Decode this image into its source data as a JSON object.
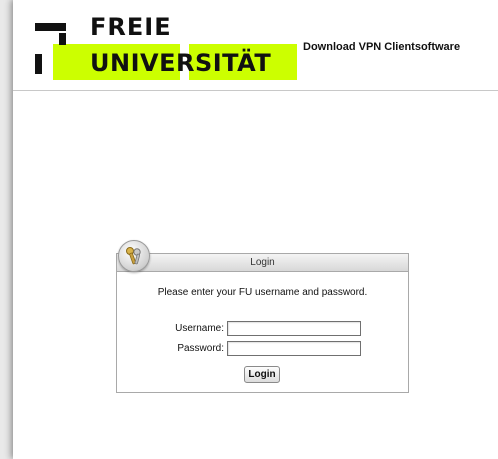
{
  "header": {
    "logo": {
      "line1": "FREIE",
      "line2": "UNIVERSITÄT"
    },
    "download_link": "Download VPN Clientsoftware"
  },
  "login": {
    "title": "Login",
    "instructions": "Please enter your FU username and password.",
    "username_label": "Username:",
    "username_value": "",
    "password_label": "Password:",
    "password_value": "",
    "submit_label": "Login"
  },
  "colors": {
    "brand_highlight": "#ccff00",
    "logo_black": "#111111"
  },
  "icons": {
    "login_badge": "keys-icon"
  }
}
